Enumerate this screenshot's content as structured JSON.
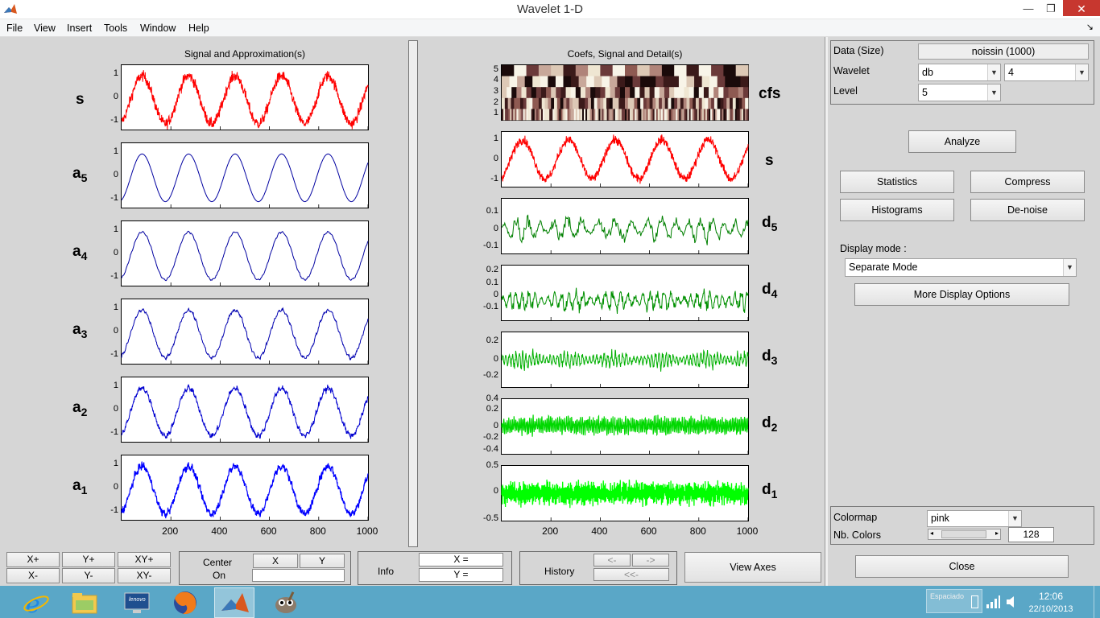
{
  "window": {
    "title": "Wavelet 1-D",
    "minimize_glyph": "—",
    "maximize_glyph": "❐",
    "close_glyph": "✕",
    "dock_glyph": "↘"
  },
  "menu": [
    "File",
    "View",
    "Insert",
    "Tools",
    "Window",
    "Help"
  ],
  "left_panel": {
    "title": "Signal and Approximation(s)",
    "rows": [
      {
        "label": "s",
        "sub": "",
        "yticks": [
          "1",
          "0",
          "-1"
        ]
      },
      {
        "label": "a",
        "sub": "5",
        "yticks": [
          "1",
          "0",
          "-1"
        ]
      },
      {
        "label": "a",
        "sub": "4",
        "yticks": [
          "1",
          "0",
          "-1"
        ]
      },
      {
        "label": "a",
        "sub": "3",
        "yticks": [
          "1",
          "0",
          "-1"
        ]
      },
      {
        "label": "a",
        "sub": "2",
        "yticks": [
          "1",
          "0",
          "-1"
        ]
      },
      {
        "label": "a",
        "sub": "1",
        "yticks": [
          "1",
          "0",
          "-1"
        ]
      }
    ],
    "xticks": [
      "200",
      "400",
      "600",
      "800",
      "1000"
    ]
  },
  "right_panel": {
    "title": "Coefs, Signal and Detail(s)",
    "rows": [
      {
        "label": "cfs",
        "sub": "",
        "yticks": [
          "5",
          "4",
          "3",
          "2",
          "1"
        ]
      },
      {
        "label": "s",
        "sub": "",
        "yticks": [
          "1",
          "0",
          "-1"
        ]
      },
      {
        "label": "d",
        "sub": "5",
        "yticks": [
          "0.1",
          "0",
          "-0.1"
        ]
      },
      {
        "label": "d",
        "sub": "4",
        "yticks": [
          "0.2",
          "0.1",
          "0",
          "-0.1"
        ]
      },
      {
        "label": "d",
        "sub": "3",
        "yticks": [
          "0.2",
          "0",
          "-0.2"
        ]
      },
      {
        "label": "d",
        "sub": "2",
        "yticks": [
          "0.4",
          "0.2",
          "0",
          "-0.2",
          "-0.4"
        ]
      },
      {
        "label": "d",
        "sub": "1",
        "yticks": [
          "0.5",
          "0",
          "-0.5"
        ]
      }
    ],
    "xticks": [
      "200",
      "400",
      "600",
      "800",
      "1000"
    ]
  },
  "controls": {
    "data_label": "Data  (Size)",
    "data_value": "noissin  (1000)",
    "wavelet_label": "Wavelet",
    "wavelet_family": "db",
    "wavelet_order": "4",
    "level_label": "Level",
    "level_value": "5",
    "analyze": "Analyze",
    "statistics": "Statistics",
    "compress": "Compress",
    "histograms": "Histograms",
    "denoise": "De-noise",
    "display_mode_label": "Display mode :",
    "display_mode_value": "Separate Mode",
    "more_display": "More Display Options",
    "colormap_label": "Colormap",
    "colormap_value": "pink",
    "nb_colors_label": "Nb. Colors",
    "nb_colors_value": "128",
    "close": "Close"
  },
  "bottom": {
    "xplus": "X+",
    "yplus": "Y+",
    "xyplus": "XY+",
    "xminus": "X-",
    "yminus": "Y-",
    "xyminus": "XY-",
    "center": "Center",
    "on": "On",
    "cx": "X",
    "cy": "Y",
    "info": "Info",
    "info_x": "X =",
    "info_y": "Y =",
    "history": "History",
    "hist_back": "<-",
    "hist_fwd": "->",
    "hist_first": "<<-",
    "view_axes": "View Axes"
  },
  "taskbar": {
    "time": "12:06",
    "date": "22/10/2013",
    "tray_text": "Espaciado",
    "lenovo": "lenovo"
  },
  "colors": {
    "signal": "#ff0000",
    "approx_a5": "#0000a0",
    "approx_a1": "#0000ff",
    "detail_d5": "#008000",
    "detail_d1": "#00ff00"
  }
}
